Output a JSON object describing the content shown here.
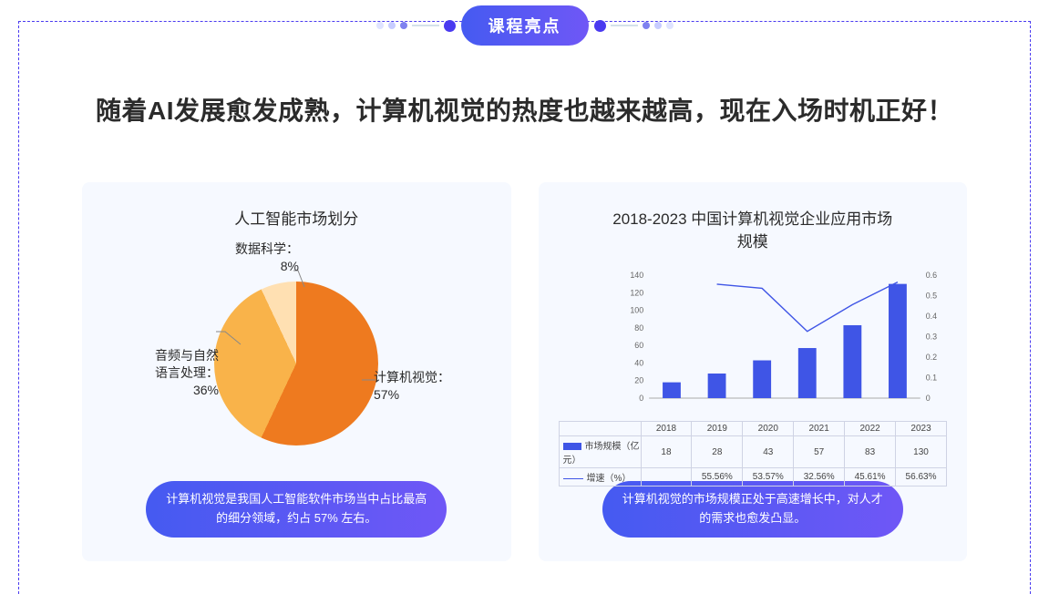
{
  "section_title": "课程亮点",
  "headline": "随着AI发展愈发成熟，计算机视觉的热度也越来越高，现在入场时机正好！",
  "card_pie": {
    "title": "人工智能市场划分",
    "labels": {
      "cv_name": "计算机视觉：",
      "cv_value": "57%",
      "nlp_name": "音频与自然",
      "nlp_name2": "语言处理：",
      "nlp_value": "36%",
      "ds_name": "数据科学：",
      "ds_value": "8%"
    },
    "callout": "计算机视觉是我国人工智能软件市场当中占比最高的细分领域，约占 57% 左右。"
  },
  "card_bar": {
    "title": "2018-2023 中国计算机视觉企业应用市场规模",
    "legend": {
      "bar": "市场规模（亿元）",
      "line": "增速（%）"
    },
    "callout": "计算机视觉的市场规模正处于高速增长中，对人才的需求也愈发凸显。"
  },
  "chart_data": [
    {
      "type": "pie",
      "title": "人工智能市场划分",
      "series": [
        {
          "name": "计算机视觉",
          "value": 57
        },
        {
          "name": "音频与自然语言处理",
          "value": 36
        },
        {
          "name": "数据科学",
          "value": 8
        }
      ]
    },
    {
      "type": "bar+line",
      "title": "2018-2023 中国计算机视觉企业应用市场规模",
      "categories": [
        "2018",
        "2019",
        "2020",
        "2021",
        "2022",
        "2023"
      ],
      "series": [
        {
          "name": "市场规模（亿元）",
          "type": "bar",
          "values": [
            18,
            28,
            43,
            57,
            83,
            130
          ],
          "axis": "left"
        },
        {
          "name": "增速（%）",
          "type": "line",
          "values": [
            null,
            55.56,
            53.57,
            32.56,
            45.61,
            56.63
          ],
          "axis": "right",
          "display": [
            "",
            "55.56%",
            "53.57%",
            "32.56%",
            "45.61%",
            "56.63%"
          ]
        }
      ],
      "y_left": {
        "min": 0,
        "max": 140,
        "step": 20,
        "label": ""
      },
      "y_right": {
        "min": 0,
        "max": 0.6,
        "step": 0.1,
        "label": ""
      }
    }
  ]
}
